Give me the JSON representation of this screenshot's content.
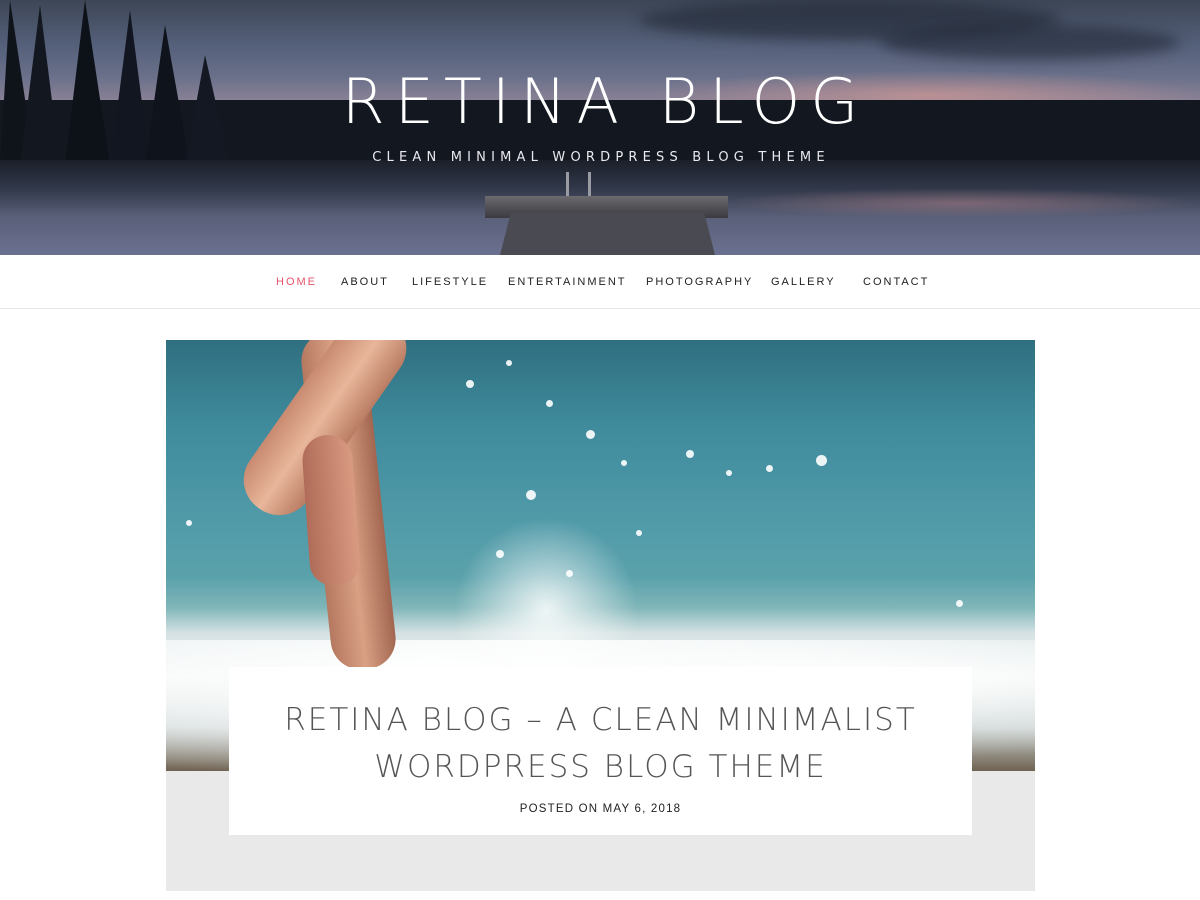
{
  "header": {
    "site_title": "RETINA BLOG",
    "tagline": "CLEAN MINIMAL WORDPRESS BLOG THEME"
  },
  "nav": {
    "items": [
      {
        "label": "HOME",
        "active": true
      },
      {
        "label": "ABOUT",
        "active": false
      },
      {
        "label": "LIFESTYLE",
        "active": false
      },
      {
        "label": "ENTERTAINMENT",
        "active": false
      },
      {
        "label": "PHOTOGRAPHY",
        "active": false
      },
      {
        "label": "GALLERY",
        "active": false
      },
      {
        "label": "CONTACT",
        "active": false
      }
    ]
  },
  "featured_post": {
    "title_line1": "RETINA BLOG – A CLEAN MINIMALIST",
    "title_line2": "WORDPRESS BLOG THEME",
    "meta_prefix": "POSTED ON",
    "date": "MAY 6, 2018"
  },
  "colors": {
    "accent": "#e5546b",
    "nav_text": "#222222",
    "title_text": "#555555",
    "card_background": "#e9e9e9"
  }
}
